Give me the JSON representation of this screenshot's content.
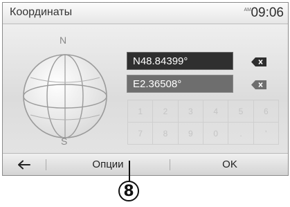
{
  "header": {
    "title": "Координаты",
    "clock_ampm": "AM",
    "time": "09:06"
  },
  "globe": {
    "north": "N",
    "south": "S"
  },
  "coordinates": {
    "latitude": "N48.84399°",
    "longitude": "E2.36508°"
  },
  "keypad": {
    "row1": [
      "1",
      "2",
      "3",
      "4",
      "5",
      "6"
    ],
    "row2": [
      "7",
      "8",
      "9",
      "0",
      ".",
      "'"
    ]
  },
  "bottombar": {
    "options_label": "Опции",
    "ok_label": "OK"
  },
  "callout": {
    "number": "8"
  },
  "icons": {
    "back": "arrow-left-icon",
    "delete": "backspace-icon"
  }
}
